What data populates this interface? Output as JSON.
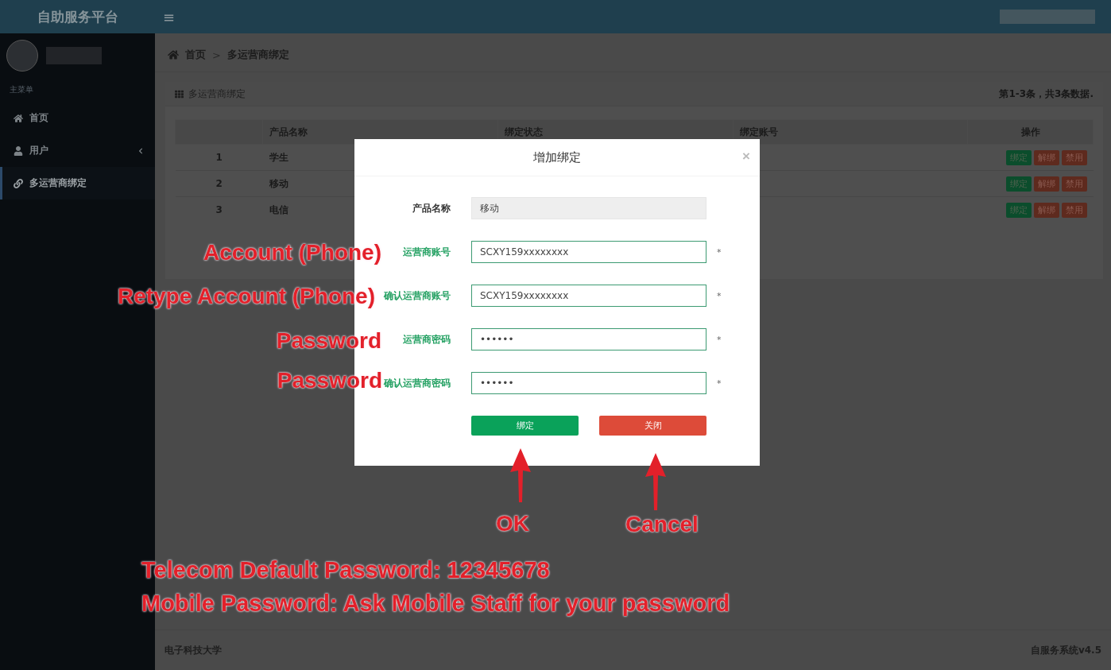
{
  "header": {
    "title": "自助服务平台",
    "menu_toggle": "≡"
  },
  "sidebar": {
    "section_label": "主菜单",
    "items": [
      {
        "label": "首页",
        "selected": false,
        "has_caret": false
      },
      {
        "label": "用户",
        "selected": false,
        "has_caret": true
      },
      {
        "label": "多运营商绑定",
        "selected": true,
        "has_caret": false
      }
    ]
  },
  "breadcrumb": {
    "items": [
      "首页",
      "多运营商绑定"
    ],
    "separator": ">"
  },
  "card": {
    "title": "多运营商绑定",
    "summary": "第1-3条，共3条数据.",
    "table": {
      "columns": [
        "",
        "产品名称",
        "绑定状态",
        "绑定账号",
        "操作"
      ],
      "rows": [
        {
          "index": "1",
          "product": "学生",
          "actions": [
            {
              "label": "绑定",
              "kind": "bind"
            },
            {
              "label": "解绑",
              "kind": "unbind"
            },
            {
              "label": "禁用",
              "kind": "disable"
            }
          ]
        },
        {
          "index": "2",
          "product": "移动",
          "actions": [
            {
              "label": "绑定",
              "kind": "bind"
            },
            {
              "label": "解绑",
              "kind": "unbind"
            },
            {
              "label": "禁用",
              "kind": "disable"
            }
          ]
        },
        {
          "index": "3",
          "product": "电信",
          "actions": [
            {
              "label": "绑定",
              "kind": "bind"
            },
            {
              "label": "解绑",
              "kind": "unbind"
            },
            {
              "label": "禁用",
              "kind": "disable"
            }
          ]
        }
      ]
    }
  },
  "dialog": {
    "title": "增加绑定",
    "close": "×",
    "fields": [
      {
        "label": "产品名称",
        "value": "移动",
        "kind": "readonly",
        "highlighted": false
      },
      {
        "label": "运营商账号",
        "value": "SCXY159xxxxxxxx",
        "kind": "input",
        "highlighted": true,
        "required_mark": "*"
      },
      {
        "label": "确认运营商账号",
        "value": "SCXY159xxxxxxxx",
        "kind": "input",
        "highlighted": true,
        "required_mark": "*"
      },
      {
        "label": "运营商密码",
        "value": "••••••",
        "kind": "input",
        "highlighted": true,
        "required_mark": "*"
      },
      {
        "label": "确认运营商密码",
        "value": "••••••",
        "kind": "input",
        "highlighted": true,
        "required_mark": "*"
      }
    ],
    "buttons": [
      {
        "label": "绑定",
        "kind": "primary"
      },
      {
        "label": "关闭",
        "kind": "danger"
      }
    ]
  },
  "annotations": [
    {
      "text": "Account (Phone)",
      "kind": "field-note"
    },
    {
      "text": "Retype Account (Phone)",
      "kind": "field-note"
    },
    {
      "text": "Password",
      "kind": "field-note"
    },
    {
      "text": "Password",
      "kind": "field-note"
    },
    {
      "text": "OK",
      "kind": "button-note"
    },
    {
      "text": "Cancel",
      "kind": "button-note"
    },
    {
      "text": "Telecom Default Password: 12345678",
      "kind": "footnote"
    },
    {
      "text": "Mobile Password: Ask Mobile Staff for your password",
      "kind": "footnote"
    }
  ],
  "footer": {
    "left": "电子科技大学",
    "right": "自服务系统v4.5"
  }
}
